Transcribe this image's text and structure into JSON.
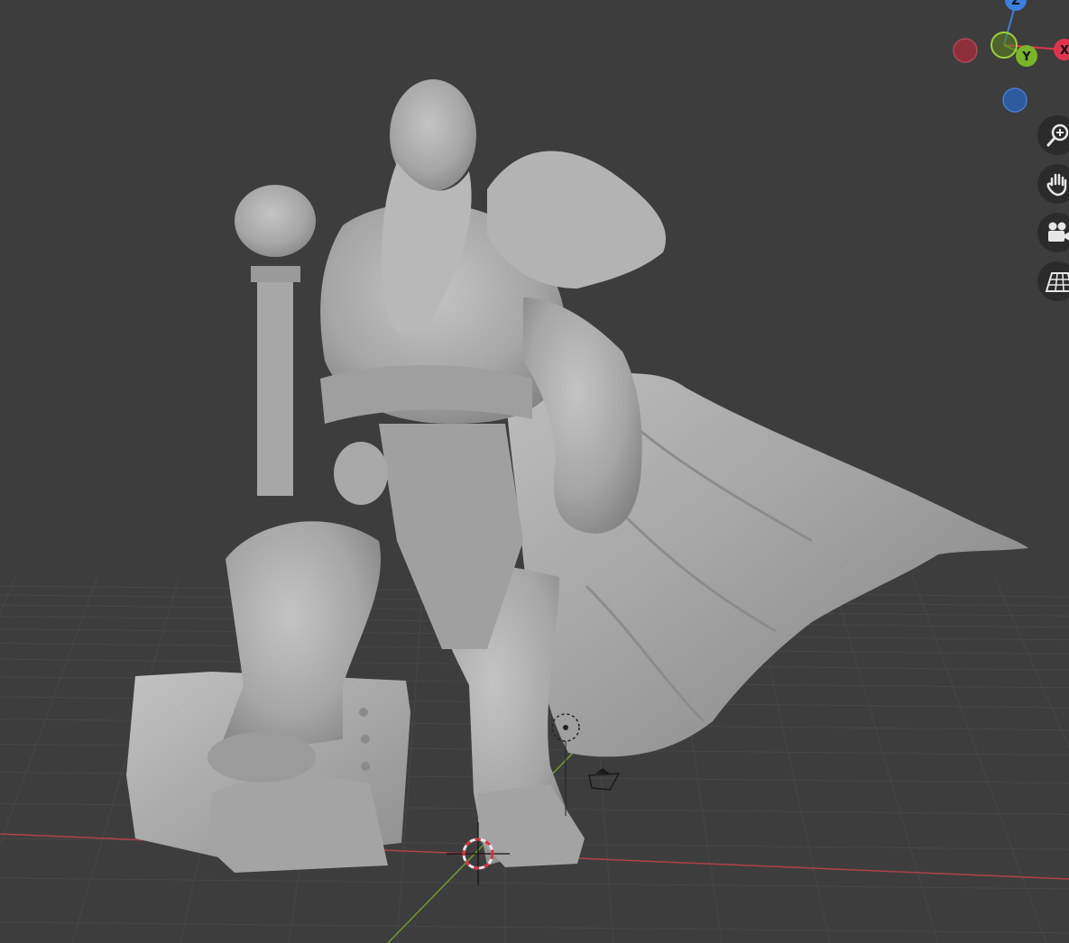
{
  "app": {
    "viewport": "3D Viewport"
  },
  "gizmo": {
    "axes": [
      {
        "key": "z",
        "label": "Z",
        "color": "#3d7fe0"
      },
      {
        "key": "x",
        "label": "X",
        "color": "#e0344d"
      },
      {
        "key": "y",
        "label": "Y",
        "color": "#7ab529"
      }
    ],
    "negative_axes": [
      {
        "key": "neg-x",
        "color": "#8e2f3c"
      },
      {
        "key": "neg-y",
        "color": "#5b7f22"
      },
      {
        "key": "neg-z",
        "color": "#2e5b9e"
      }
    ]
  },
  "navigation": {
    "buttons": [
      {
        "key": "zoom",
        "icon": "zoom-icon"
      },
      {
        "key": "pan",
        "icon": "hand-icon"
      },
      {
        "key": "camera",
        "icon": "camera-icon"
      },
      {
        "key": "perspective",
        "icon": "grid-perspective-icon"
      }
    ]
  },
  "colors": {
    "background": "#3d3d3d",
    "grid": "#474747",
    "x_axis_line": "#b0414a",
    "y_axis_line": "#6f9a2c",
    "model": "#a9a9a9",
    "model_shadow": "#7a7a7a",
    "nav_button": "#2b2b2b"
  }
}
